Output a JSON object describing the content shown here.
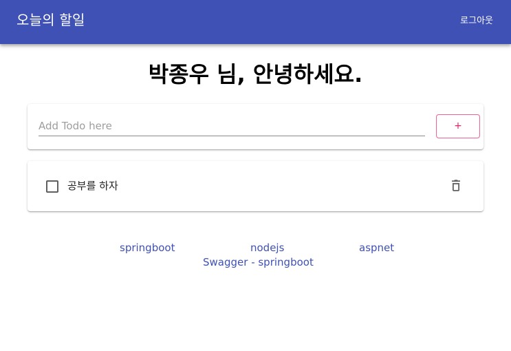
{
  "app": {
    "title": "오늘의 할일",
    "logout_label": "로그아웃"
  },
  "greeting": "박종우 님, 안녕하세요.",
  "add_todo": {
    "placeholder": "Add Todo here",
    "value": "",
    "button_label": "+"
  },
  "todos": [
    {
      "title": "공부를 하자",
      "checked": false
    }
  ],
  "footer_links": [
    "springboot",
    "nodejs",
    "aspnet",
    "Swagger - springboot"
  ],
  "colors": {
    "appbar": "#3f51b5",
    "accent": "#e91e63",
    "link": "#3f51b5"
  },
  "icons": {
    "delete": "trash-icon",
    "checkbox": "checkbox-unchecked-icon"
  }
}
